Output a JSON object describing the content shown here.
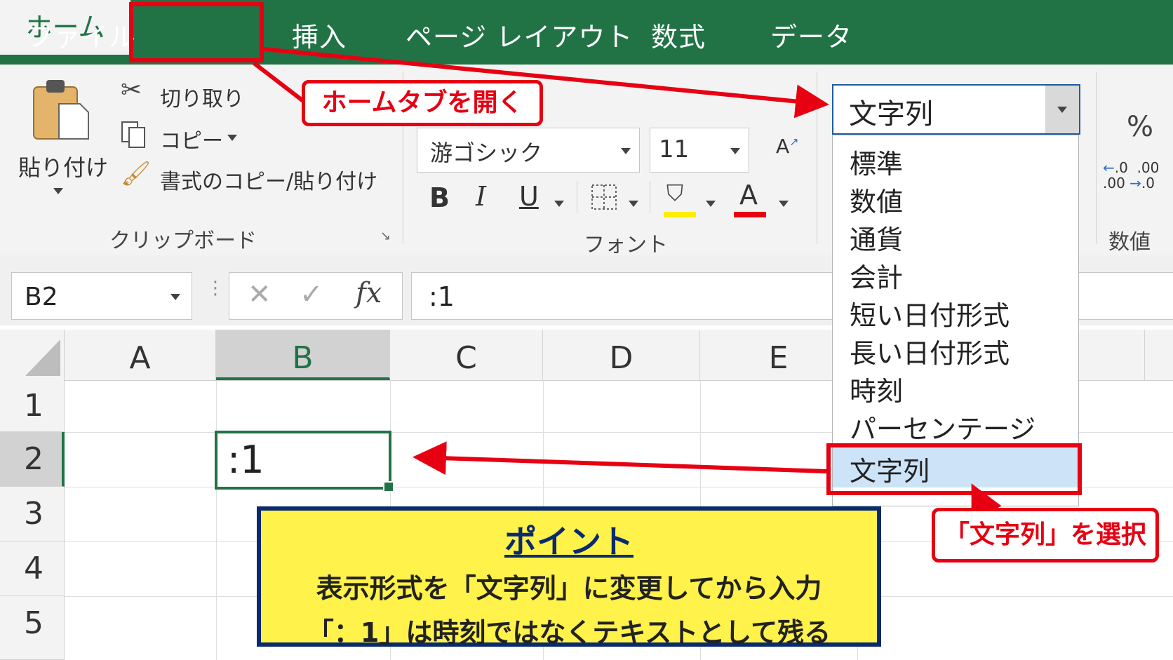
{
  "tabs": [
    "ファイル",
    "ホーム",
    "挿入",
    "ページ レイアウト",
    "数式",
    "データ"
  ],
  "clipboard": {
    "paste_label": "貼り付け",
    "cut_label": "切り取り",
    "copy_label": "コピー",
    "format_painter_label": "書式のコピー/貼り付け",
    "group_label": "クリップボード"
  },
  "font": {
    "name": "游ゴシック",
    "size": "11",
    "bold": "B",
    "italic": "I",
    "underline": "U",
    "font_color_glyph": "A",
    "group_label": "フォント",
    "fill_color": "#ffee00",
    "text_color": "#e60012"
  },
  "number": {
    "format_value": "文字列",
    "percent": "%",
    "group_label": "数値",
    "format_options": [
      "標準",
      "数値",
      "通貨",
      "会計",
      "短い日付形式",
      "長い日付形式",
      "時刻",
      "パーセンテージ",
      "文字列"
    ],
    "selected_index": 8
  },
  "formula_bar": {
    "name_box": "B2",
    "fx": "fx",
    "content": ":1"
  },
  "grid": {
    "columns": [
      "A",
      "B",
      "C",
      "D",
      "E"
    ],
    "rows": [
      "1",
      "2",
      "3",
      "4",
      "5"
    ],
    "active_cell": "B2",
    "active_cell_value": ":1"
  },
  "annotations": {
    "home_tab_note": "ホームタブを開く",
    "select_note": "「文字列」を選択",
    "point_title": "ポイント",
    "point_line1": "表示形式を「文字列」に変更してから入力",
    "point_line2": "「：1」は時刻ではなくテキストとして残る"
  },
  "colors": {
    "excel_green": "#217346",
    "annotation_red": "#e60012",
    "point_yellow": "#fff24a",
    "point_border": "#0a2a6e",
    "selected_option": "#cde3f7"
  }
}
